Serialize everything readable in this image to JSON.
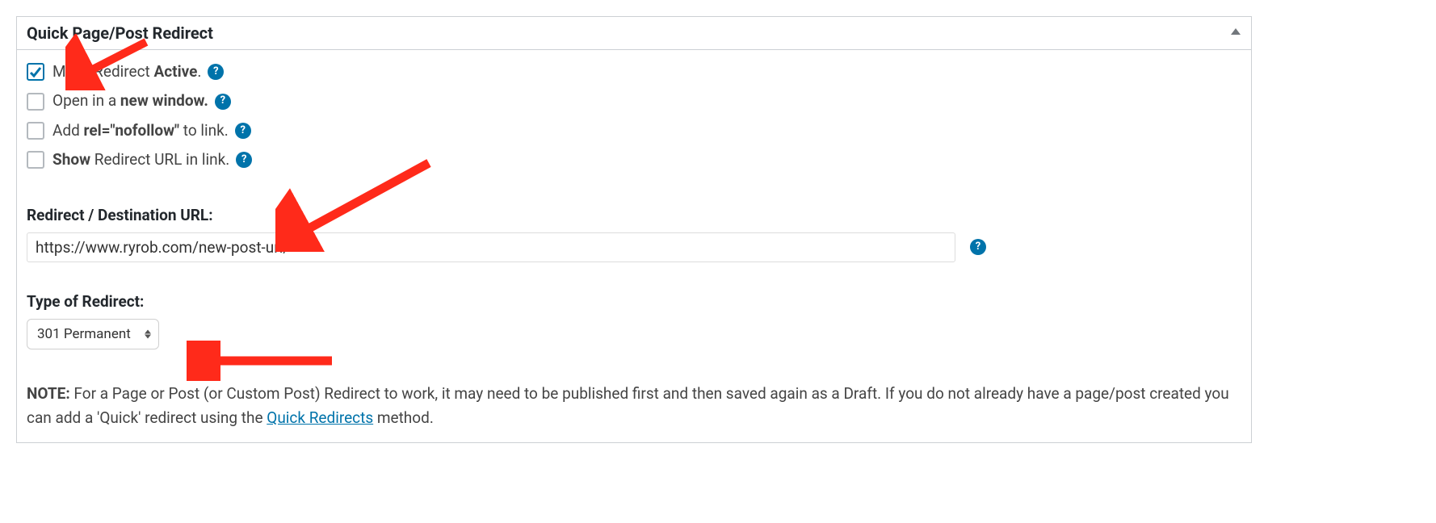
{
  "panel": {
    "title": "Quick Page/Post Redirect"
  },
  "options": {
    "active": {
      "pre": "Make Redirect ",
      "strong": "Active",
      "post": ".",
      "checked": true
    },
    "newwindow": {
      "pre": "Open in a ",
      "strong": "new window.",
      "post": "",
      "checked": false
    },
    "nofollow": {
      "pre": "Add ",
      "strong": "rel=\"nofollow\"",
      "post": " to link.",
      "checked": false
    },
    "showurl": {
      "strong": "Show",
      "post": " Redirect URL in link.",
      "checked": false
    }
  },
  "url": {
    "label": "Redirect / Destination URL:",
    "value": "https://www.ryrob.com/new-post-url/"
  },
  "type": {
    "label": "Type of Redirect:",
    "selected": "301 Permanent"
  },
  "note": {
    "prefix": "NOTE:",
    "text_before_link": " For a Page or Post (or Custom Post) Redirect to work, it may need to be published first and then saved again as a Draft. If you do not already have a page/post created you can add a 'Quick' redirect using the ",
    "link_text": "Quick Redirects",
    "text_after_link": " method."
  },
  "help_glyph": "?"
}
